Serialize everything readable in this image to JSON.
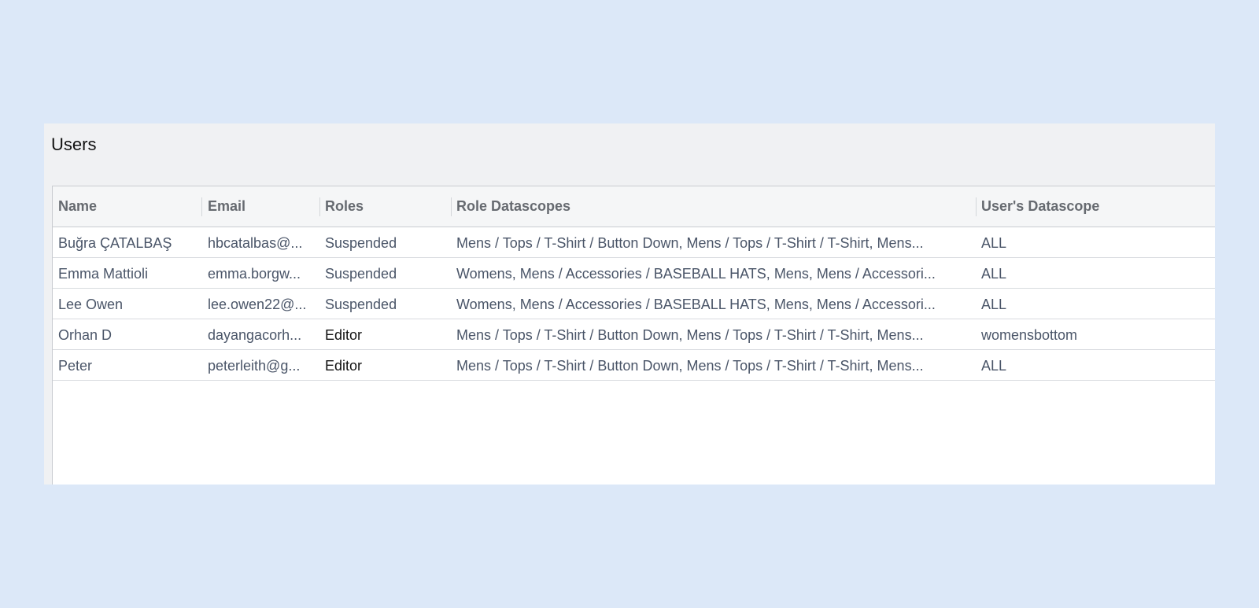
{
  "panel": {
    "title": "Users"
  },
  "table": {
    "columns": [
      "Name",
      "Email",
      "Roles",
      "Role Datascopes",
      "User's Datascope"
    ],
    "rows": [
      {
        "name": "Buğra ÇATALBAŞ",
        "email": "hbcatalbas@...",
        "roles": "Suspended",
        "role_datascopes": "Mens / Tops / T-Shirt / Button Down, Mens / Tops / T-Shirt / T-Shirt, Mens...",
        "user_datascope": "ALL"
      },
      {
        "name": "Emma Mattioli",
        "email": "emma.borgw...",
        "roles": "Suspended",
        "role_datascopes": "Womens, Mens / Accessories / BASEBALL HATS, Mens, Mens / Accessori...",
        "user_datascope": "ALL"
      },
      {
        "name": "Lee Owen",
        "email": "lee.owen22@...",
        "roles": "Suspended",
        "role_datascopes": "Womens, Mens / Accessories / BASEBALL HATS, Mens, Mens / Accessori...",
        "user_datascope": "ALL"
      },
      {
        "name": "Orhan D",
        "email": "dayangacorh...",
        "roles": "Editor",
        "role_datascopes": "Mens / Tops / T-Shirt / Button Down, Mens / Tops / T-Shirt / T-Shirt, Mens...",
        "user_datascope": "womensbottom"
      },
      {
        "name": "Peter",
        "email": "peterleith@g...",
        "roles": "Editor",
        "role_datascopes": "Mens / Tops / T-Shirt / Button Down, Mens / Tops / T-Shirt / T-Shirt, Mens...",
        "user_datascope": "ALL"
      }
    ]
  }
}
